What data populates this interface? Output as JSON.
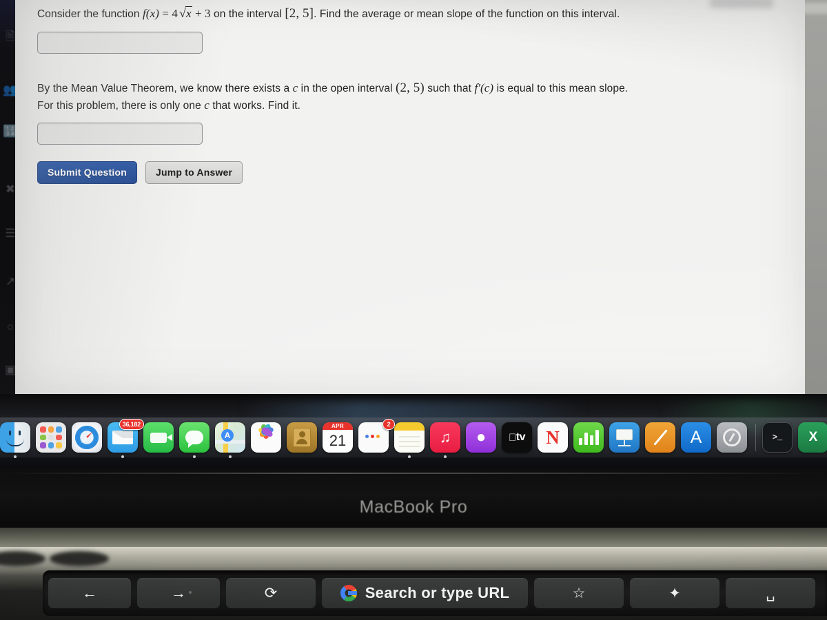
{
  "webpage": {
    "question1": {
      "text_before": "Consider the function ",
      "fn": "f(x)",
      "eq": " = ",
      "coeff": "4",
      "radicand": "x",
      "plus": " + 3",
      "text_mid": " on the interval ",
      "interval": "[2, 5]",
      "text_after": ". Find the average or mean slope of the function on this interval.",
      "answer_value": "",
      "answer_placeholder": ""
    },
    "question2": {
      "part1": "By the Mean Value Theorem, we know there exists a ",
      "c1": "c",
      "part2": " in the open interval ",
      "interval": "(2, 5)",
      "part3": " such that ",
      "fprime": "f'(c)",
      "part4": " is equal to this mean slope. For this problem, there is only one ",
      "c2": "c",
      "part5": " that works. Find it.",
      "answer_value": "",
      "answer_placeholder": ""
    },
    "buttons": {
      "submit_label": "Submit Question",
      "jump_label": "Jump to Answer",
      "submit_color": "#2e5aa8"
    }
  },
  "dock": {
    "items": [
      {
        "name": "finder",
        "label": "Finder",
        "badge": null,
        "running": true
      },
      {
        "name": "launchpad",
        "label": "Launchpad",
        "badge": null,
        "running": false
      },
      {
        "name": "safari",
        "label": "Safari",
        "badge": null,
        "running": false
      },
      {
        "name": "mail",
        "label": "Mail",
        "badge": "36,182",
        "running": true
      },
      {
        "name": "facetime",
        "label": "FaceTime",
        "badge": null,
        "running": false
      },
      {
        "name": "messages",
        "label": "Messages",
        "badge": null,
        "running": true
      },
      {
        "name": "maps",
        "label": "Maps",
        "badge": null,
        "running": true
      },
      {
        "name": "photos",
        "label": "Photos",
        "badge": null,
        "running": false
      },
      {
        "name": "contacts",
        "label": "Contacts",
        "badge": null,
        "running": false
      },
      {
        "name": "calendar",
        "label": "Calendar",
        "badge": null,
        "running": false,
        "month": "APR",
        "day": "21"
      },
      {
        "name": "reminders",
        "label": "Reminders",
        "badge": "2",
        "running": false
      },
      {
        "name": "notes",
        "label": "Notes",
        "badge": null,
        "running": true
      },
      {
        "name": "music",
        "label": "Music",
        "badge": null,
        "running": true
      },
      {
        "name": "podcasts",
        "label": "Podcasts",
        "badge": null,
        "running": false
      },
      {
        "name": "appletv",
        "label": "TV",
        "badge": null,
        "running": false,
        "glyph": "tv"
      },
      {
        "name": "news",
        "label": "News",
        "badge": null,
        "running": false
      },
      {
        "name": "numbers",
        "label": "Numbers",
        "badge": null,
        "running": false
      },
      {
        "name": "keynote",
        "label": "Keynote",
        "badge": null,
        "running": false
      },
      {
        "name": "pages",
        "label": "Pages",
        "badge": null,
        "running": false
      },
      {
        "name": "appstore",
        "label": "App Store",
        "badge": null,
        "running": false,
        "glyph": "A"
      },
      {
        "name": "system-preferences",
        "label": "System Preferences",
        "badge": null,
        "running": false
      },
      {
        "name": "terminal",
        "label": "Terminal",
        "badge": null,
        "running": false,
        "glyph": ">_"
      },
      {
        "name": "excel",
        "label": "Microsoft Excel",
        "badge": null,
        "running": false,
        "glyph": "X"
      }
    ]
  },
  "laptop": {
    "brand_label": "MacBook Pro"
  },
  "touchbar": {
    "back_glyph": "←",
    "forward_glyph": "→",
    "reload_glyph": "⟳",
    "url_label": "Search or type URL",
    "bookmark_glyph": "☆",
    "newtab_glyph": "✦",
    "end_glyph": "␣"
  }
}
